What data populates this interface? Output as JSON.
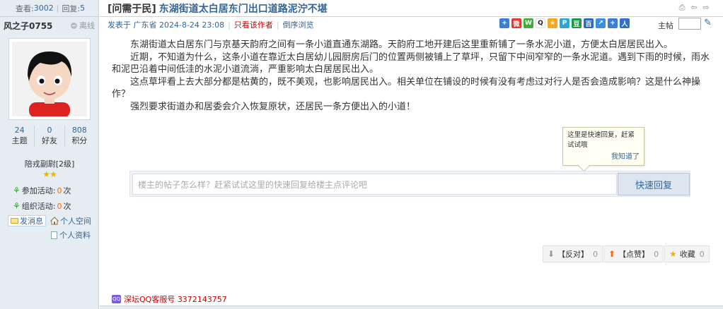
{
  "stats": {
    "views_label": "查看:",
    "views": "3002",
    "sep": "|",
    "replies_label": "回复:",
    "replies": "5"
  },
  "user": {
    "name": "风之子0755",
    "status": "离线",
    "counts": [
      {
        "value": "24",
        "label": "主题"
      },
      {
        "value": "0",
        "label": "好友"
      },
      {
        "value": "808",
        "label": "积分"
      }
    ],
    "rank": "陪戎副尉[2级]",
    "activities": [
      {
        "label": "参加活动:",
        "value": "0",
        "unit": "次"
      },
      {
        "label": "组织活动:",
        "value": "0",
        "unit": "次"
      }
    ],
    "send_message": "发消息",
    "personal_space": "个人空间",
    "personal_profile": "个人资料"
  },
  "thread": {
    "category": "[问需于民]",
    "title": "东湖街道太白居东门出口道路泥泞不堪"
  },
  "meta": {
    "posted_prefix": "发表于 广东省 2024-8-24 23:08",
    "author_only": "只看该作者",
    "reverse": "倒序浏览",
    "floor_label": "主帖"
  },
  "post": {
    "paragraphs": [
      "东湖街道太白居东门与京基天韵府之间有一条小道直通东湖路。天韵府工地开建后这里重新铺了一条水泥小道，方便太白居居民出入。",
      "近期，不知道为什么，这条小道在靠近太白居幼儿园厨房后门的位置两侧被铺上了草坪，只留下中间窄窄的一条水泥道。遇到下雨的时候，雨水和泥巴沿着中间低洼的水泥小道流淌，严重影响太白居居民出入。",
      "这点草坪看上去大部分都是枯黄的，既不美观，也影响居民出入。相关单位在铺设的时候有没有考虑过对行人是否会造成影响？这是什么神操作？",
      "强烈要求街道办和居委会介入恢复原状，还居民一条方便出入的小道！"
    ]
  },
  "tooltip": {
    "text": "这里是快速回复，赶紧试试哦",
    "ok": "我知道了"
  },
  "quick_reply": {
    "placeholder": "楼主的帖子怎么样？赶紧试试这里的快速回复给楼主点评论吧",
    "button": "快速回复"
  },
  "votes": [
    {
      "label": "【反对】",
      "count": "0"
    },
    {
      "label": "【点赞】",
      "count": "0"
    },
    {
      "label": "收藏",
      "count": "0"
    }
  ],
  "footer": {
    "qq": "深坛QQ客服号 3372143757"
  },
  "colors": {
    "link": "#336699",
    "accent_red": "#cc0000",
    "sidebar_bg": "#e5edf2"
  }
}
